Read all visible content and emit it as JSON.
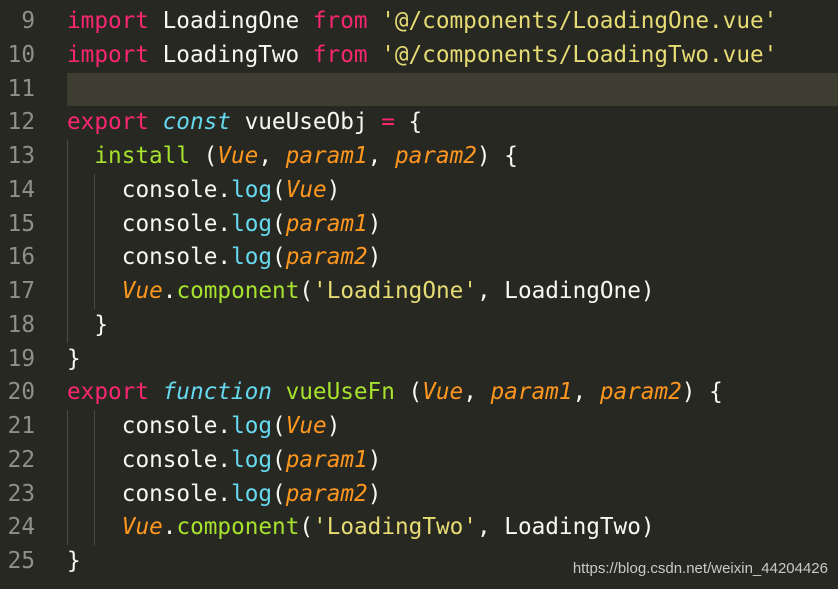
{
  "colors": {
    "background": "#272822",
    "current_line": "#3e3d32",
    "keyword": "#f92672",
    "storage": "#66d9ef",
    "function": "#a6e22e",
    "parameter": "#fd971f",
    "string": "#e6db74",
    "text": "#f8f8f2",
    "line_number": "#8f908a"
  },
  "highlighted_line": "11",
  "lines": [
    {
      "num": "9",
      "indent": 0,
      "tokens": [
        {
          "t": "kw",
          "c": "import"
        },
        {
          "t": "pl",
          "c": " LoadingOne "
        },
        {
          "t": "kw",
          "c": "from"
        },
        {
          "t": "pl",
          "c": " "
        },
        {
          "t": "str",
          "c": "'@/components/LoadingOne.vue'"
        }
      ]
    },
    {
      "num": "10",
      "indent": 0,
      "tokens": [
        {
          "t": "kw",
          "c": "import"
        },
        {
          "t": "pl",
          "c": " LoadingTwo "
        },
        {
          "t": "kw",
          "c": "from"
        },
        {
          "t": "pl",
          "c": " "
        },
        {
          "t": "str",
          "c": "'@/components/LoadingTwo.vue'"
        }
      ]
    },
    {
      "num": "11",
      "indent": 0,
      "tokens": []
    },
    {
      "num": "12",
      "indent": 0,
      "tokens": [
        {
          "t": "kw",
          "c": "export"
        },
        {
          "t": "pl",
          "c": " "
        },
        {
          "t": "st",
          "c": "const"
        },
        {
          "t": "pl",
          "c": " vueUseObj "
        },
        {
          "t": "kw",
          "c": "="
        },
        {
          "t": "pl",
          "c": " {"
        }
      ]
    },
    {
      "num": "13",
      "indent": 1,
      "tokens": [
        {
          "t": "fn",
          "c": "install"
        },
        {
          "t": "pl",
          "c": " ("
        },
        {
          "t": "pa",
          "c": "Vue"
        },
        {
          "t": "pl",
          "c": ", "
        },
        {
          "t": "pa",
          "c": "param1"
        },
        {
          "t": "pl",
          "c": ", "
        },
        {
          "t": "pa",
          "c": "param2"
        },
        {
          "t": "pl",
          "c": ") {"
        }
      ]
    },
    {
      "num": "14",
      "indent": 2,
      "tokens": [
        {
          "t": "pl",
          "c": "console."
        },
        {
          "t": "sp",
          "c": "log"
        },
        {
          "t": "pl",
          "c": "("
        },
        {
          "t": "pa",
          "c": "Vue"
        },
        {
          "t": "pl",
          "c": ")"
        }
      ]
    },
    {
      "num": "15",
      "indent": 2,
      "tokens": [
        {
          "t": "pl",
          "c": "console."
        },
        {
          "t": "sp",
          "c": "log"
        },
        {
          "t": "pl",
          "c": "("
        },
        {
          "t": "pa",
          "c": "param1"
        },
        {
          "t": "pl",
          "c": ")"
        }
      ]
    },
    {
      "num": "16",
      "indent": 2,
      "tokens": [
        {
          "t": "pl",
          "c": "console."
        },
        {
          "t": "sp",
          "c": "log"
        },
        {
          "t": "pl",
          "c": "("
        },
        {
          "t": "pa",
          "c": "param2"
        },
        {
          "t": "pl",
          "c": ")"
        }
      ]
    },
    {
      "num": "17",
      "indent": 2,
      "tokens": [
        {
          "t": "pa",
          "c": "Vue"
        },
        {
          "t": "pl",
          "c": "."
        },
        {
          "t": "fn",
          "c": "component"
        },
        {
          "t": "pl",
          "c": "("
        },
        {
          "t": "str",
          "c": "'LoadingOne'"
        },
        {
          "t": "pl",
          "c": ", LoadingOne)"
        }
      ]
    },
    {
      "num": "18",
      "indent": 1,
      "tokens": [
        {
          "t": "pl",
          "c": "}"
        }
      ]
    },
    {
      "num": "19",
      "indent": 0,
      "tokens": [
        {
          "t": "pl",
          "c": "}"
        }
      ]
    },
    {
      "num": "20",
      "indent": 0,
      "tokens": [
        {
          "t": "kw",
          "c": "export"
        },
        {
          "t": "pl",
          "c": " "
        },
        {
          "t": "st",
          "c": "function"
        },
        {
          "t": "pl",
          "c": " "
        },
        {
          "t": "fn",
          "c": "vueUseFn"
        },
        {
          "t": "pl",
          "c": " ("
        },
        {
          "t": "pa",
          "c": "Vue"
        },
        {
          "t": "pl",
          "c": ", "
        },
        {
          "t": "pa",
          "c": "param1"
        },
        {
          "t": "pl",
          "c": ", "
        },
        {
          "t": "pa",
          "c": "param2"
        },
        {
          "t": "pl",
          "c": ") {"
        }
      ]
    },
    {
      "num": "21",
      "indent": 2,
      "tokens": [
        {
          "t": "pl",
          "c": "console."
        },
        {
          "t": "sp",
          "c": "log"
        },
        {
          "t": "pl",
          "c": "("
        },
        {
          "t": "pa",
          "c": "Vue"
        },
        {
          "t": "pl",
          "c": ")"
        }
      ]
    },
    {
      "num": "22",
      "indent": 2,
      "tokens": [
        {
          "t": "pl",
          "c": "console."
        },
        {
          "t": "sp",
          "c": "log"
        },
        {
          "t": "pl",
          "c": "("
        },
        {
          "t": "pa",
          "c": "param1"
        },
        {
          "t": "pl",
          "c": ")"
        }
      ]
    },
    {
      "num": "23",
      "indent": 2,
      "tokens": [
        {
          "t": "pl",
          "c": "console."
        },
        {
          "t": "sp",
          "c": "log"
        },
        {
          "t": "pl",
          "c": "("
        },
        {
          "t": "pa",
          "c": "param2"
        },
        {
          "t": "pl",
          "c": ")"
        }
      ]
    },
    {
      "num": "24",
      "indent": 2,
      "tokens": [
        {
          "t": "pa",
          "c": "Vue"
        },
        {
          "t": "pl",
          "c": "."
        },
        {
          "t": "fn",
          "c": "component"
        },
        {
          "t": "pl",
          "c": "("
        },
        {
          "t": "str",
          "c": "'LoadingTwo'"
        },
        {
          "t": "pl",
          "c": ", LoadingTwo)"
        }
      ]
    },
    {
      "num": "25",
      "indent": 0,
      "tokens": [
        {
          "t": "pl",
          "c": "}"
        }
      ]
    }
  ],
  "watermark": "https://blog.csdn.net/weixin_44204426"
}
